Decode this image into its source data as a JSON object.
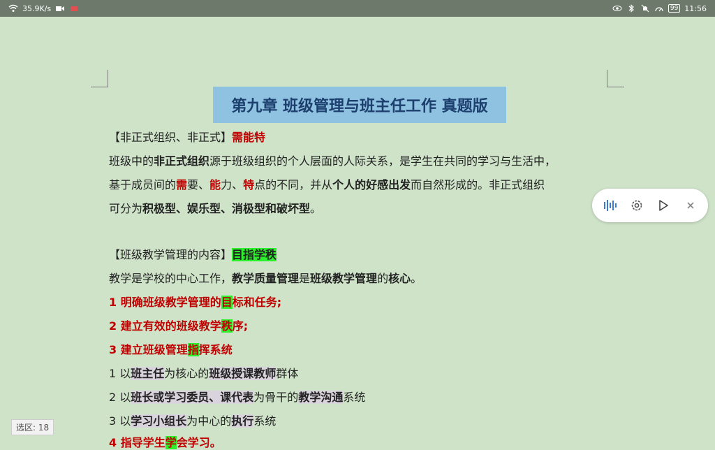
{
  "status": {
    "net_speed": "35.9K/s",
    "battery": "99",
    "time": "11:56"
  },
  "doc": {
    "title": "第九章  班级管理与班主任工作  真题版",
    "s1": {
      "bracket": "【非正式组织、非正式】",
      "key": "需能特",
      "p1a": "班级中的",
      "p1b": "非正式组织",
      "p1c": "源于班级组织的个人层面的人际关系，是学生在共同的学习与生活中，",
      "p2a": "基于成员间的",
      "p2b": "需",
      "p2c": "要、",
      "p2d": "能",
      "p2e": "力、",
      "p2f": "特",
      "p2g": "点的不同，并从",
      "p2h": "个人的好感出发",
      "p2i": "而自然形成的。非正式组织",
      "p3a": "可分为",
      "p3b": "积极型、娱乐型、消极型和破坏型",
      "p3c": "。"
    },
    "s2": {
      "bracket": "【班级教学管理的内容】",
      "key": "目指学秩",
      "p1a": "教学是学校的中心工作，",
      "p1b": "教学质量管理",
      "p1c": "是",
      "p1d": "班级教学管理",
      "p1e": "的",
      "p1f": "核心",
      "p1g": "。",
      "i1a": "1 明确班级教学管理的",
      "i1b": "目",
      "i1c": "标和任务;",
      "i2a": "2 建立有效的班级教学",
      "i2b": "秩",
      "i2c": "序;",
      "i3a": "3 建立班级管理",
      "i3b": "指",
      "i3c": "挥系统",
      "j1a": "1 以",
      "j1b": "班主任",
      "j1c": "为核心的",
      "j1d": "班级授课教师",
      "j1e": "群体",
      "j2a": "2 以",
      "j2b": "班长或学习委员、课代表",
      "j2c": "为骨干的",
      "j2d": "教学沟通",
      "j2e": "系统",
      "j3a": "3 以",
      "j3b": "学习小组长",
      "j3c": "为中心的",
      "j3d": "执行",
      "j3e": "系统",
      "i4a": "4 指导学生",
      "i4b": "学",
      "i4c": "会学习。"
    }
  },
  "selection": {
    "label": "选区: 18"
  },
  "toolbar": {
    "icons": [
      "voice-wave-icon",
      "gear-icon",
      "play-icon",
      "close-icon"
    ]
  },
  "colors": {
    "background": "#cfe3c9",
    "title_bg": "#8fc1e0",
    "title_text": "#1c3f6e",
    "emphasis_red": "#c00000",
    "highlight_green": "#2cf02c",
    "highlight_gray": "#d9d3dd"
  }
}
